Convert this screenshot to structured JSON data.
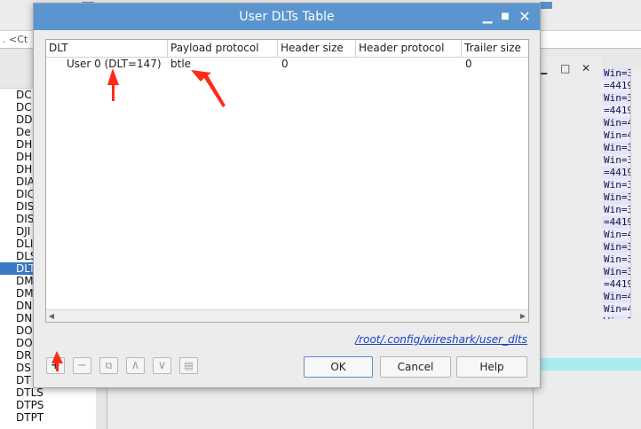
{
  "background": {
    "filter_text": ". <Ct",
    "protocol_list": [
      "DC",
      "DC",
      "DD",
      "De",
      "DH",
      "DH",
      "DH",
      "DIA",
      "DIC",
      "DIS",
      "DIS",
      "DJI",
      "DLI",
      "DLS",
      "DLT",
      "DM",
      "DM",
      "DN",
      "DN",
      "DO",
      "DO",
      "DR",
      "DS",
      "DT",
      "DTLS",
      "DTPS",
      "DTPT"
    ],
    "selected_protocol_index": 14,
    "packet_lines": [
      "Win=3",
      "=4419",
      "Win=3",
      "=4419",
      "Win=4",
      "Win=4",
      "Win=3",
      "Win=3",
      "=4419",
      "Win=3",
      "Win=3",
      "Win=3",
      "=4419",
      "Win=4",
      "Win=3",
      "Win=3",
      "Win=3",
      "=4419",
      "Win=4",
      "Win=4",
      "Win=3"
    ]
  },
  "dialog": {
    "title": "User DLTs Table",
    "columns": [
      "DLT",
      "Payload protocol",
      "Header size",
      "Header protocol",
      "Trailer size"
    ],
    "rows": [
      {
        "dlt": "User 0 (DLT=147)",
        "payload_protocol": "btle",
        "header_size": "0",
        "header_protocol": "",
        "trailer_size": "0"
      }
    ],
    "config_path": "/root/.config/wireshark/user_dlts",
    "ok_label": "OK",
    "cancel_label": "Cancel",
    "help_label": "Help",
    "toolbar_glyphs": {
      "add": "+",
      "remove": "−",
      "copy": "⧉",
      "up": "∧",
      "down": "∨",
      "clear": "▤"
    },
    "accent_color": "#5a95cf",
    "annotation_color": "#ff2a1a"
  }
}
